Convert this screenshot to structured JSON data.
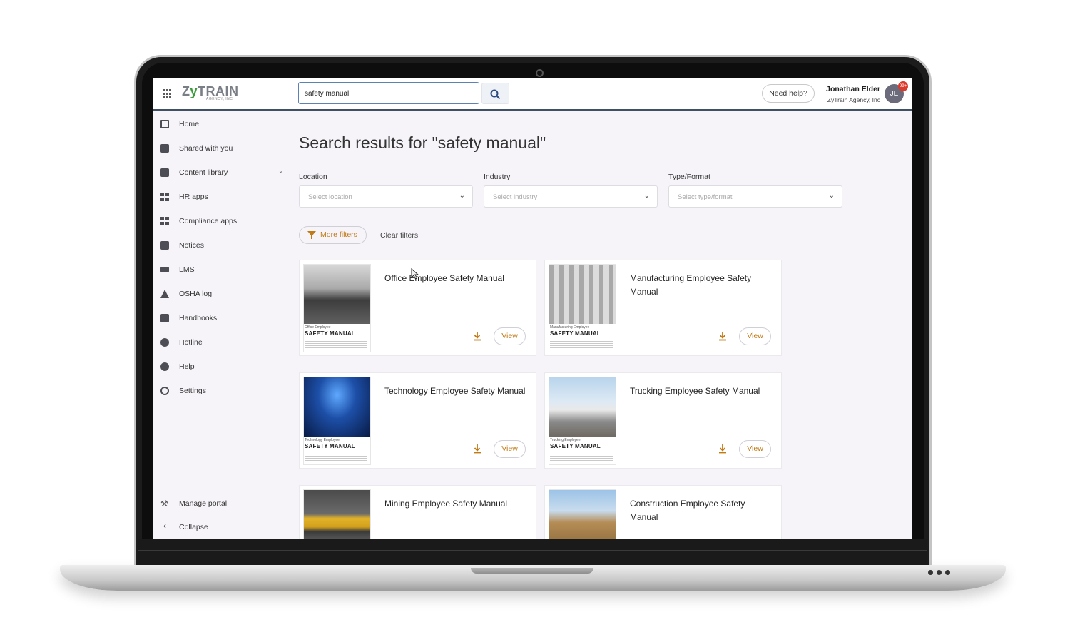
{
  "app": {
    "logo_text_a": "Z",
    "logo_text_y": "y",
    "logo_text_b": "TRAIN",
    "logo_sub": "AGENCY, INC"
  },
  "header": {
    "search_value": "safety manual",
    "help_label": "Need help?",
    "user_name": "Jonathan Elder",
    "user_org": "ZyTrain Agency, Inc",
    "avatar_initials": "JE",
    "notification_count": "99+"
  },
  "sidebar": {
    "items": [
      {
        "label": "Home",
        "icon": "home-icon"
      },
      {
        "label": "Shared with you",
        "icon": "shared-icon"
      },
      {
        "label": "Content library",
        "icon": "library-icon"
      },
      {
        "label": "HR apps",
        "icon": "apps-icon"
      },
      {
        "label": "Compliance apps",
        "icon": "apps-icon"
      },
      {
        "label": "Notices",
        "icon": "notices-icon"
      },
      {
        "label": "LMS",
        "icon": "graduation-cap-icon"
      },
      {
        "label": "OSHA log",
        "icon": "cone-icon"
      },
      {
        "label": "Handbooks",
        "icon": "book-icon"
      },
      {
        "label": "Hotline",
        "icon": "phone-icon"
      },
      {
        "label": "Help",
        "icon": "help-icon"
      },
      {
        "label": "Settings",
        "icon": "gear-icon"
      }
    ],
    "manage_portal": "Manage portal",
    "collapse": "Collapse"
  },
  "main": {
    "title": "Search results for \"safety manual\"",
    "filters": {
      "location_label": "Location",
      "location_placeholder": "Select location",
      "industry_label": "Industry",
      "industry_placeholder": "Select industry",
      "type_label": "Type/Format",
      "type_placeholder": "Select type/format",
      "more_filters": "More filters",
      "clear_filters": "Clear filters"
    },
    "results": [
      {
        "title": "Office Employee Safety Manual",
        "thumb_sub": "Office Employee",
        "thumb_title": "SAFETY MANUAL",
        "view": "View"
      },
      {
        "title": "Manufacturing Employee Safety Manual",
        "thumb_sub": "Manufacturing Employee",
        "thumb_title": "SAFETY MANUAL",
        "view": "View"
      },
      {
        "title": "Technology Employee Safety Manual",
        "thumb_sub": "Technology Employee",
        "thumb_title": "SAFETY MANUAL",
        "view": "View"
      },
      {
        "title": "Trucking Employee Safety Manual",
        "thumb_sub": "Trucking Employee",
        "thumb_title": "SAFETY MANUAL",
        "view": "View"
      },
      {
        "title": "Mining Employee Safety Manual",
        "thumb_sub": "",
        "thumb_title": "",
        "view": ""
      },
      {
        "title": "Construction Employee Safety Manual",
        "thumb_sub": "",
        "thumb_title": "",
        "view": ""
      }
    ]
  },
  "colors": {
    "accent": "#c07a16",
    "header_border": "#3e5066",
    "logo_green": "#3a9b3a",
    "badge": "#d93a2b"
  }
}
